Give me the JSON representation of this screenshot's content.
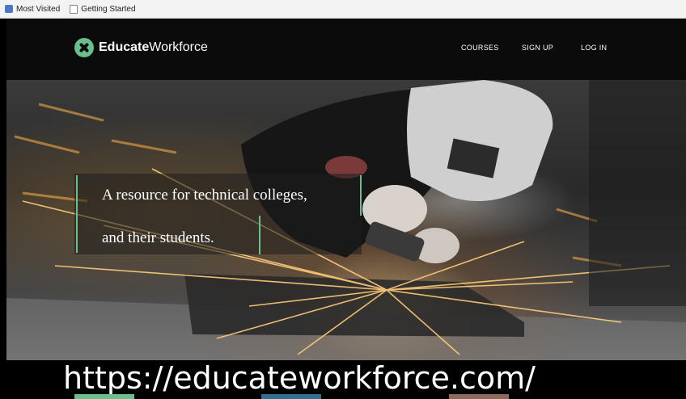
{
  "bookmarks": {
    "items": [
      {
        "label": "Most Visited",
        "icon": "bookmark-folder-icon"
      },
      {
        "label": "Getting Started",
        "icon": "page-icon"
      }
    ]
  },
  "header": {
    "logo_bold": "Educate",
    "logo_regular": "Workforce",
    "nav": [
      {
        "label": "COURSES"
      },
      {
        "label": "SIGN UP"
      },
      {
        "label": "LOG IN"
      }
    ]
  },
  "hero": {
    "tagline_line1": "A resource for technical colleges,",
    "tagline_line2": "and their students."
  },
  "caption": {
    "url": "https://educateworkforce.com/"
  },
  "colors": {
    "accent": "#6bbf8e",
    "navbar": "#0b0b0b",
    "tile_1": "#6bbf8e",
    "tile_2": "#2f6f8f",
    "tile_3": "#8a6a5a"
  }
}
